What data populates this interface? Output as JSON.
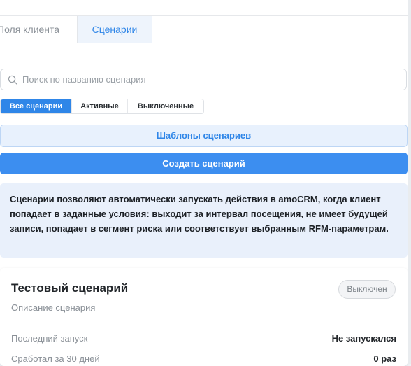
{
  "tabs": [
    {
      "label": "Поля клиента",
      "active": false
    },
    {
      "label": "Сценарии",
      "active": true
    }
  ],
  "search": {
    "placeholder": "Поиск по названию сценария",
    "value": ""
  },
  "filters": [
    {
      "label": "Все сценарии",
      "active": true
    },
    {
      "label": "Активные",
      "active": false
    },
    {
      "label": "Выключенные",
      "active": false
    }
  ],
  "buttons": {
    "templates": "Шаблоны сценариев",
    "create": "Создать сценарий"
  },
  "info_text": "Сценарии позволяют автоматически запускать действия в amoCRM, когда клиент попадает в заданные условия: выходит за интервал посещения, не имеет будущей записи, попадает в сегмент риска или соответствует выбранным RFM-параметрам.",
  "scenario_card": {
    "title": "Тестовый сценарий",
    "status": "Выключен",
    "description": "Описание сценария",
    "rows": [
      {
        "label": "Последний запуск",
        "value": "Не запускался"
      },
      {
        "label": "Сработал за 30 дней",
        "value": "0 раз"
      }
    ]
  },
  "colors": {
    "accent": "#2f86e8",
    "primary_button": "#3c8ef0",
    "info_background": "#e9f0fb",
    "tab_active_background": "#eef4fc"
  }
}
